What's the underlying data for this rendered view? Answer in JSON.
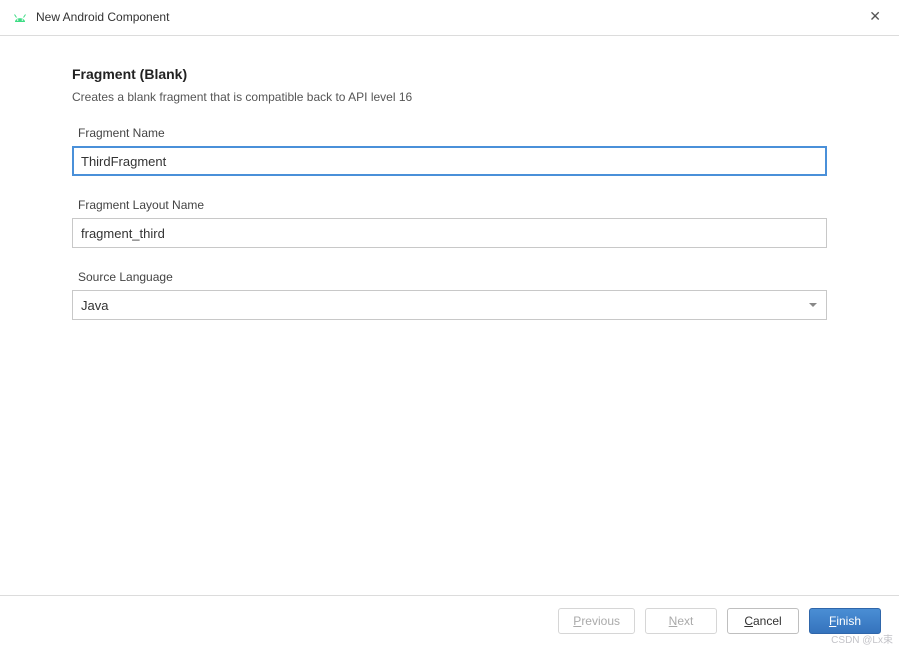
{
  "window": {
    "title": "New Android Component"
  },
  "page": {
    "heading": "Fragment (Blank)",
    "subtitle": "Creates a blank fragment that is compatible back to API level 16"
  },
  "fields": {
    "fragment_name": {
      "label": "Fragment Name",
      "value": "ThirdFragment"
    },
    "layout_name": {
      "label": "Fragment Layout Name",
      "value": "fragment_third"
    },
    "source_language": {
      "label": "Source Language",
      "value": "Java"
    }
  },
  "buttons": {
    "previous": "Previous",
    "next": "Next",
    "cancel": "Cancel",
    "finish": "Finish"
  },
  "watermark": "CSDN @Lx束"
}
